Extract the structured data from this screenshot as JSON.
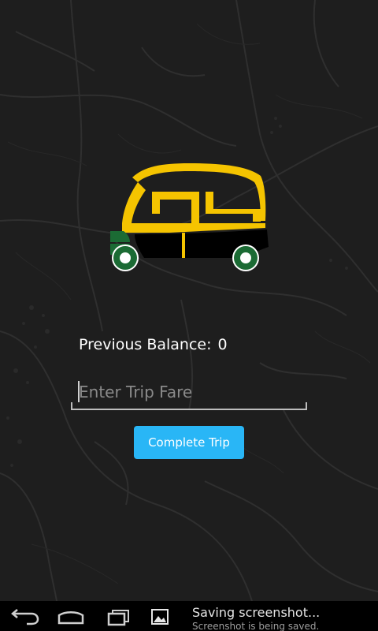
{
  "balance": {
    "label": "Previous Balance:",
    "value": "0"
  },
  "fare": {
    "placeholder": "Enter Trip Fare",
    "value": ""
  },
  "actions": {
    "complete_label": "Complete Trip"
  },
  "colors": {
    "accent": "#29b6f6",
    "logo_yellow": "#f5c400",
    "logo_green": "#1b6b34",
    "background": "#1e1e1e"
  },
  "navbar": {
    "back_icon": "back-icon",
    "home_icon": "home-icon",
    "recents_icon": "recents-icon"
  },
  "notification": {
    "icon": "image-icon",
    "title": "Saving screenshot...",
    "subtitle": "Screenshot is being saved."
  }
}
